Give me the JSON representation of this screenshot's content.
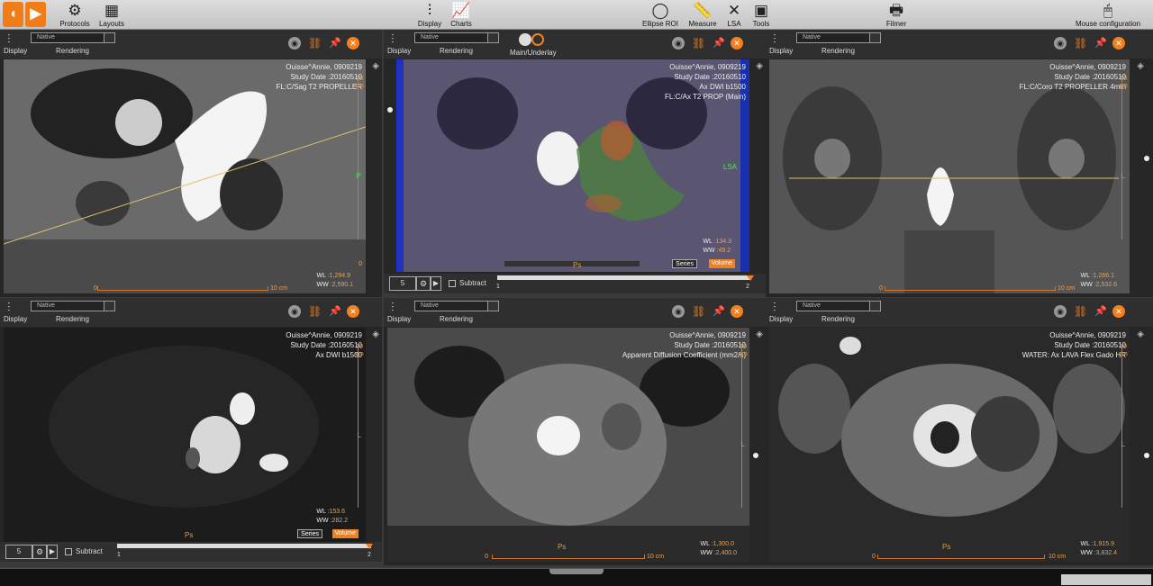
{
  "toolbar": {
    "protocols": "Protocols",
    "layouts": "Layouts",
    "display": "Display",
    "charts": "Charts",
    "ellipse_roi": "Ellipse ROI",
    "measure": "Measure",
    "lsa": "LSA",
    "tools": "Tools",
    "filmer": "Filmer",
    "mouse_configuration": "Mouse configuration"
  },
  "common": {
    "display_label": "Display",
    "rendering_label": "Rendering",
    "select_value": "Native",
    "main_underlay": "Main/Underlay",
    "subtract": "Subtract",
    "series_tag": "Series",
    "volume_tag": "Volume",
    "scale_zero": "0",
    "scale_10cm": "10 cm",
    "vscale_top": "10 cm",
    "patient": "Ouisse^Annie, 0909219",
    "study_date": "Study Date :20160510",
    "frame_num": "5",
    "slider_min": "1",
    "slider_max": "2"
  },
  "viewports": [
    {
      "series": "FL:C/Sag T2 PROPELLER",
      "series2": "",
      "wl": ":1,294.9",
      "ww": ":2,590.1",
      "orient_r": "P",
      "orient_b": ""
    },
    {
      "series": "Ax DWI b1500",
      "series2": "FL:C/Ax T2 PROP (Main)",
      "wl": ":134.3",
      "ww": ":49.2",
      "orient_r": "LSA",
      "orient_b": "Ps"
    },
    {
      "series": "FL:C/Coro T2 PROPELLER 4mm",
      "series2": "",
      "wl": ":1,266.1",
      "ww": ":2,532.6",
      "orient_r": "L",
      "orient_b": ""
    },
    {
      "series": "Ax DWI b1500",
      "series2": "",
      "wl": ":153.6",
      "ww": ":282.2",
      "orient_r": "L",
      "orient_b": "Ps"
    },
    {
      "series": "Apparent Diffusion Coefficient (mm2/s)",
      "series2": "",
      "wl": ":1,300.0",
      "ww": ":2,400.0",
      "orient_r": "L",
      "orient_b": "Ps"
    },
    {
      "series": "WATER: Ax LAVA Flex Gado HR",
      "series2": "",
      "wl": ":1,915.9",
      "ww": ":3,832.4",
      "orient_r": "L",
      "orient_b": "Ps"
    }
  ],
  "colors": {
    "accent": "#f08020",
    "panel": "#2f2f2f",
    "toolbar": "#d0d0d0"
  }
}
